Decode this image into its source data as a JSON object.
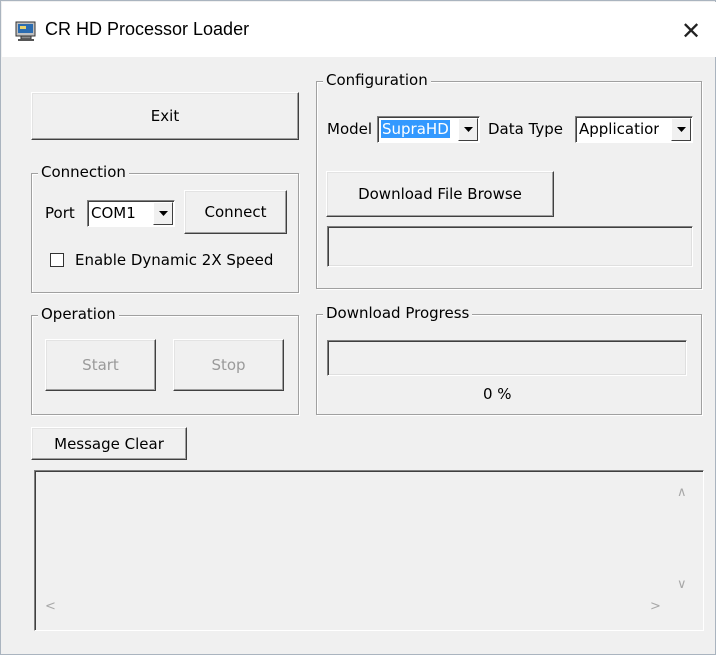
{
  "window": {
    "title": "CR HD Processor Loader",
    "close_glyph": "✕",
    "icon": "app-icon"
  },
  "buttons": {
    "exit": "Exit",
    "connect": "Connect",
    "start": "Start",
    "stop": "Stop",
    "message_clear": "Message Clear",
    "download_browse": "Download File Browse"
  },
  "connection": {
    "legend": "Connection",
    "port_label": "Port",
    "port_value": "COM1",
    "dynamic_speed_label": "Enable Dynamic 2X Speed",
    "dynamic_speed_checked": false
  },
  "configuration": {
    "legend": "Configuration",
    "model_label": "Model",
    "model_value": "SupraHD",
    "data_type_label": "Data Type",
    "data_type_value": "Applicatior",
    "file_path": ""
  },
  "operation": {
    "legend": "Operation"
  },
  "download_progress": {
    "legend": "Download Progress",
    "percent_text": "0 %",
    "fraction": 0
  },
  "messages": {
    "content": ""
  },
  "colors": {
    "face": "#f0f0f0",
    "selection": "#3399ff",
    "disabled_text": "#9a9a9a"
  }
}
